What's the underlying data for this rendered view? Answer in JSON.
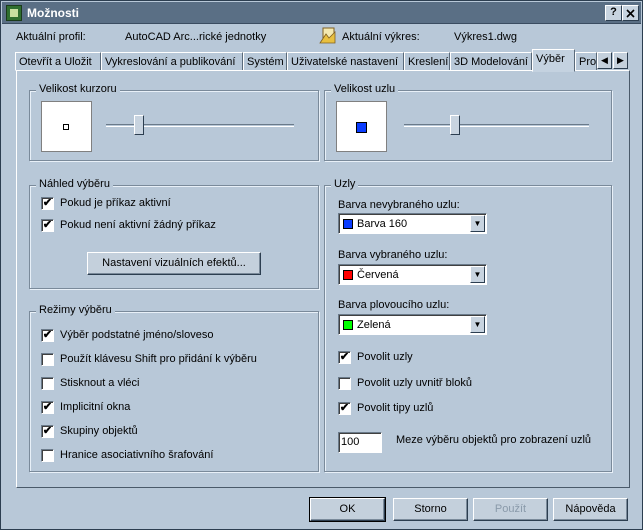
{
  "window": {
    "title": "Možnosti",
    "help_button": "?",
    "close_button": "x"
  },
  "profile": {
    "label": "Aktuální profil:",
    "value": "AutoCAD Arc...rické jednotky",
    "drawing_label": "Aktuální výkres:",
    "drawing_value": "Výkres1.dwg"
  },
  "tabs": [
    {
      "label": "Otevřít a Uložit"
    },
    {
      "label": "Vykreslování a publikování"
    },
    {
      "label": "Systém"
    },
    {
      "label": "Uživatelské nastavení"
    },
    {
      "label": "Kreslení"
    },
    {
      "label": "3D Modelování"
    },
    {
      "label": "Výběr"
    },
    {
      "label": "Pro"
    }
  ],
  "tab_scroll": {
    "left": "◀",
    "right": "▶"
  },
  "cursor_size": {
    "title": "Velikost kurzoru",
    "level": 0.16
  },
  "grip_size": {
    "title": "Velikost uzlu",
    "level": 0.26,
    "swatch_color": "#0a3cff"
  },
  "selection_preview": {
    "title": "Náhled výběru",
    "options": [
      {
        "label": "Pokud je příkaz aktivní",
        "checked": true
      },
      {
        "label": "Pokud není aktivní žádný příkaz",
        "checked": true
      }
    ],
    "visual_effects_button": "Nastavení vizuálních efektů..."
  },
  "selection_modes": {
    "title": "Režimy výběru",
    "options": [
      {
        "label": "Výběr podstatné jméno/sloveso",
        "checked": true
      },
      {
        "label": "Použít klávesu Shift pro přidání k výběru",
        "checked": false
      },
      {
        "label": "Stisknout a vléci",
        "checked": false
      },
      {
        "label": "Implicitní okna",
        "checked": true
      },
      {
        "label": "Skupiny objektů",
        "checked": true
      },
      {
        "label": "Hranice asociativního šrafování",
        "checked": false
      }
    ]
  },
  "grips": {
    "title": "Uzly",
    "unselected_label": "Barva nevybraného uzlu:",
    "unselected_value": "Barva 160",
    "unselected_color": "#0a3cff",
    "selected_label": "Barva vybraného uzlu:",
    "selected_value": "Červená",
    "selected_color": "#ff0000",
    "hover_label": "Barva plovoucího uzlu:",
    "hover_value": "Zelená",
    "hover_color": "#00ff00",
    "options": [
      {
        "label": "Povolit uzly",
        "checked": true
      },
      {
        "label": "Povolit uzly uvnitř bloků",
        "checked": false
      },
      {
        "label": "Povolit tipy uzlů",
        "checked": true
      }
    ],
    "limit_value": "100",
    "limit_label": "Meze výběru objektů pro zobrazení uzlů"
  },
  "footer": {
    "ok": "OK",
    "cancel": "Storno",
    "apply": "Použít",
    "help": "Nápověda"
  },
  "check_mark": "✔"
}
